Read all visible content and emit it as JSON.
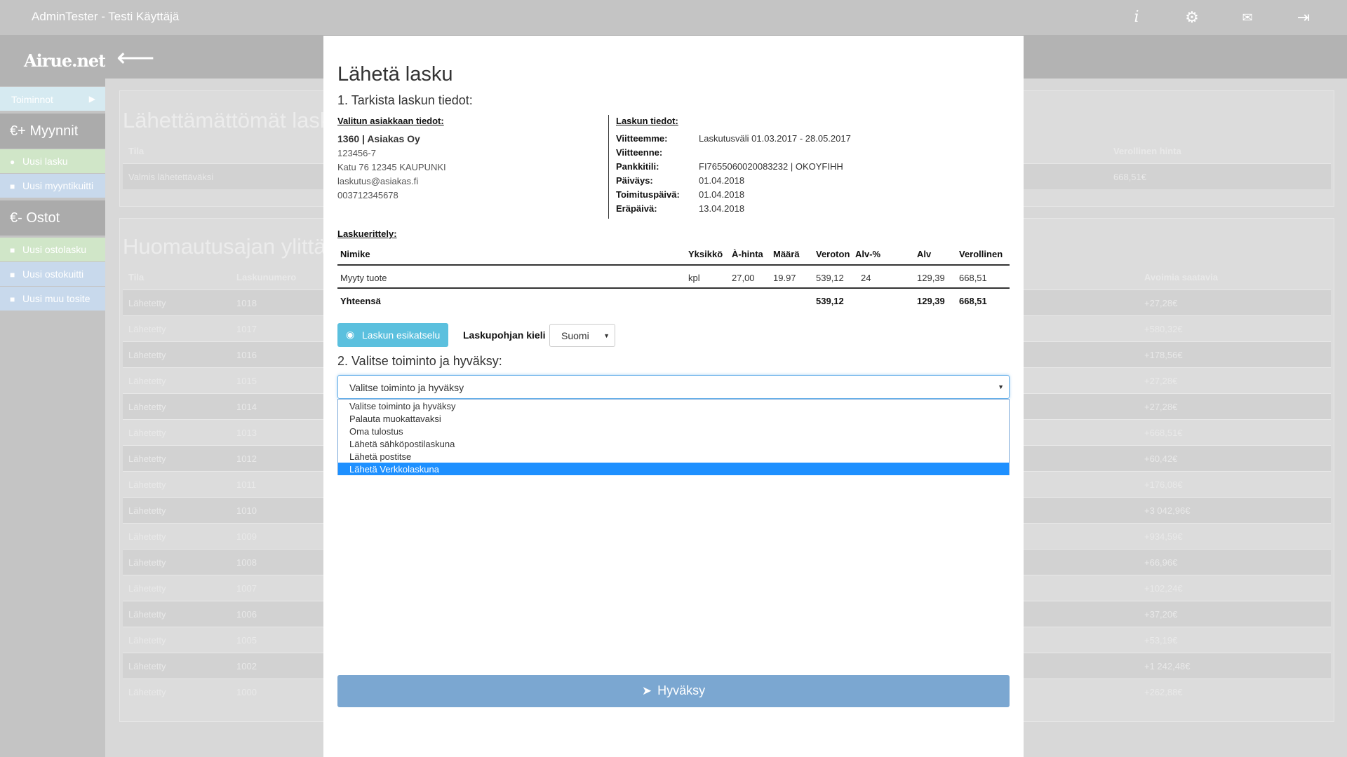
{
  "topbar": {
    "title": "AdminTester - Testi Käyttäjä"
  },
  "sidebar": {
    "logo": "Airue.net",
    "toiminnot": "Toiminnot",
    "myynnit": "€+  Myynnit",
    "uusi_lasku": "Uusi lasku",
    "uusi_myyntikuitti": "Uusi myyntikuitti",
    "ostot": "€-  Ostot",
    "uusi_ostolasku": "Uusi ostolasku",
    "uusi_ostokuitti": "Uusi ostokuitti",
    "uusi_muu_tosite": "Uusi muu tosite"
  },
  "background": {
    "panel1": {
      "title": "Lähettämättömät lask",
      "col_tila": "Tila",
      "col_verollinen": "Verollinen hinta",
      "row_tila": "Valmis lähetettäväksi",
      "row_hinta": "668,51€"
    },
    "panel2": {
      "title": "Huomautusajan ylittän",
      "col_tila": "Tila",
      "col_laskunumero": "Laskunumero",
      "col_avoimia": "Avoimia saatavia",
      "rows": [
        {
          "tila": "Lähetetty",
          "nro": "1018",
          "saatava": "+27,28€"
        },
        {
          "tila": "Lähetetty",
          "nro": "1017",
          "saatava": "+580,32€"
        },
        {
          "tila": "Lähetetty",
          "nro": "1016",
          "saatava": "+178,56€"
        },
        {
          "tila": "Lähetetty",
          "nro": "1015",
          "saatava": "+27,28€"
        },
        {
          "tila": "Lähetetty",
          "nro": "1014",
          "saatava": "+27,28€"
        },
        {
          "tila": "Lähetetty",
          "nro": "1013",
          "saatava": "+668,51€"
        },
        {
          "tila": "Lähetetty",
          "nro": "1012",
          "saatava": "+60,42€"
        },
        {
          "tila": "Lähetetty",
          "nro": "1011",
          "saatava": "+176,08€"
        },
        {
          "tila": "Lähetetty",
          "nro": "1010",
          "saatava": "+3 042,96€"
        },
        {
          "tila": "Lähetetty",
          "nro": "1009",
          "saatava": "+934,59€"
        },
        {
          "tila": "Lähetetty",
          "nro": "1008",
          "saatava": "+66,96€"
        },
        {
          "tila": "Lähetetty",
          "nro": "1007",
          "saatava": "+102,24€"
        },
        {
          "tila": "Lähetetty",
          "nro": "1006",
          "saatava": "+37,20€"
        },
        {
          "tila": "Lähetetty",
          "nro": "1005",
          "saatava": "+53,19€"
        },
        {
          "tila": "Lähetetty",
          "nro": "1002",
          "saatava": "+1 242,48€"
        },
        {
          "tila": "Lähetetty",
          "nro": "1000",
          "saatava": "+262,88€"
        }
      ]
    }
  },
  "modal": {
    "title": "Lähetä lasku",
    "step1": "1. Tarkista laskun tiedot:",
    "customer": {
      "heading": "Valitun asiakkaan tiedot:",
      "name": "1360 | Asiakas Oy",
      "business_id": "123456-7",
      "address": "Katu 76 12345 KAUPUNKI",
      "email": "laskutus@asiakas.fi",
      "phone": "003712345678"
    },
    "invoice": {
      "heading": "Laskun tiedot:",
      "viitteemme_label": "Viitteemme:",
      "viitteemme": "Laskutusväli 01.03.2017 - 28.05.2017",
      "viitteenne_label": "Viitteenne:",
      "pankkitili_label": "Pankkitili:",
      "pankkitili": "FI7655060020083232 | OKOYFIHH",
      "paivays_label": "Päiväys:",
      "paivays": "01.04.2018",
      "toimituspaiva_label": "Toimituspäivä:",
      "toimituspaiva": "01.04.2018",
      "erapaiva_label": "Eräpäivä:",
      "erapaiva": "13.04.2018"
    },
    "items": {
      "heading": "Laskuerittely:",
      "headers": {
        "nimike": "Nimike",
        "yksikko": "Yksikkö",
        "ahinta": "À-hinta",
        "maara": "Määrä",
        "veroton": "Veroton",
        "alvp": "Alv-%",
        "alv": "Alv",
        "verollinen": "Verollinen"
      },
      "row": {
        "nimike": "Myyty tuote",
        "yksikko": "kpl",
        "ahinta": "27,00",
        "maara": "19.97",
        "veroton": "539,12",
        "alvp": "24",
        "alv": "129,39",
        "verollinen": "668,51"
      },
      "total": {
        "label": "Yhteensä",
        "veroton": "539,12",
        "alv": "129,39",
        "verollinen": "668,51"
      }
    },
    "preview_button": "Laskun esikatselu",
    "lang_label": "Laskupohjan kieli",
    "lang_value": "Suomi",
    "step2": "2. Valitse toiminto ja hyväksy:",
    "action_select": "Valitse toiminto ja hyväksy",
    "action_options": [
      "Valitse toiminto ja hyväksy",
      "Palauta muokattavaksi",
      "Oma tulostus",
      "Lähetä sähköpostilaskuna",
      "Lähetä postitse",
      "Lähetä Verkkolaskuna"
    ],
    "approve_button": "Hyväksy"
  }
}
